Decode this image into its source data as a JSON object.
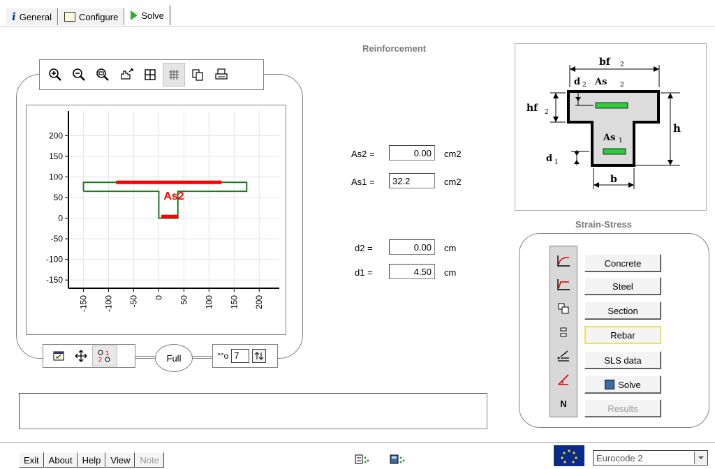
{
  "tabs": [
    {
      "label": "General",
      "icon": "info-icon"
    },
    {
      "label": "Configure",
      "icon": "configure-icon"
    },
    {
      "label": "Solve",
      "icon": "play-icon"
    }
  ],
  "reinforcement": {
    "title": "Reinforcement",
    "as2_label": "As2 =",
    "as2_value": "0.00",
    "as2_unit": "cm2",
    "as1_label": "As1 =",
    "as1_value": "32.2",
    "as1_unit": "cm2",
    "d2_label": "d2 =",
    "d2_value": "0.00",
    "d2_unit": "cm",
    "d1_label": "d1 =",
    "d1_value": "4.50",
    "d1_unit": "cm"
  },
  "section_diagram": {
    "bf": "bf",
    "sub2": "2",
    "d": "d",
    "as": "As",
    "sub1": "1",
    "hf": "hf",
    "h": "h",
    "b": "b"
  },
  "chart_data": {
    "type": "scatter",
    "xticks": [
      "-150",
      "-100",
      "-50",
      "0",
      "50",
      "100",
      "150",
      "200"
    ],
    "yticks": [
      "200",
      "150",
      "100",
      "50",
      "0",
      "-50",
      "-100",
      "-150"
    ],
    "xlim": [
      -180,
      240
    ],
    "ylim": [
      -170,
      260
    ],
    "grid": true,
    "section_outline": [
      [
        -150,
        65
      ],
      [
        -150,
        87
      ],
      [
        175,
        87
      ],
      [
        175,
        65
      ],
      [
        38,
        65
      ],
      [
        38,
        0
      ],
      [
        0,
        0
      ],
      [
        0,
        65
      ],
      [
        -150,
        65
      ]
    ],
    "rebars": [
      {
        "name": "As2",
        "x1": -85,
        "x2": 125,
        "y": 87
      },
      {
        "name": "As1",
        "x1": 5,
        "x2": 38,
        "y": 4
      }
    ],
    "annotation": {
      "text": "As2",
      "x": 30,
      "y": 45
    }
  },
  "chart_controls": {
    "full_label": "Full",
    "step_value": "7"
  },
  "strain_stress": {
    "title": "Strain-Stress",
    "buttons": [
      "Concrete",
      "Steel",
      "Section",
      "Rebar",
      "SLS data",
      "Solve",
      "Results"
    ],
    "n_label": "N"
  },
  "status_text": "",
  "bottom": {
    "buttons": [
      "Exit",
      "About",
      "Help",
      "View",
      "Note"
    ],
    "code_select": "Eurocode 2"
  },
  "colors": {
    "outline": "#1a7a1a",
    "rebar": "#ff0000",
    "green_bar": "#2ecc40",
    "selected_button_border": "#e8e35a"
  }
}
